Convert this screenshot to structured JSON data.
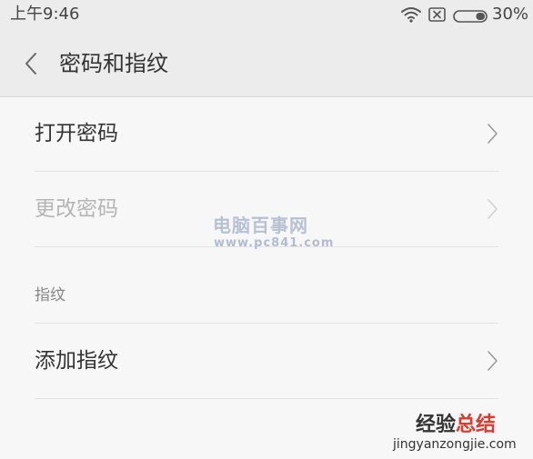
{
  "status_bar": {
    "time": "上午9:46",
    "battery_text": "30%",
    "battery_level": 0.3,
    "icons": [
      "wifi-icon",
      "no-sim-icon",
      "battery-icon"
    ]
  },
  "nav": {
    "back_icon": "chevron-left-icon",
    "title": "密码和指纹"
  },
  "rows": [
    {
      "label": "打开密码",
      "enabled": true
    },
    {
      "label": "更改密码",
      "enabled": false
    }
  ],
  "section": {
    "label": "指纹",
    "rows": [
      {
        "label": "添加指纹",
        "enabled": true
      }
    ]
  },
  "watermarks": {
    "center_title": "电脑百事网",
    "center_url": "www.pc841.com",
    "corner_title_a": "经验",
    "corner_title_b": "总结",
    "corner_url": "jingyanzongjie.com"
  },
  "colors": {
    "header_bg": "#ececec",
    "page_bg": "#f7f7f7",
    "text_primary": "#333333",
    "text_disabled": "#b5b5b5",
    "chevron": "#9a9a9a",
    "chevron_disabled": "#d0d0d0",
    "corner_accent": "#e03a2e"
  }
}
